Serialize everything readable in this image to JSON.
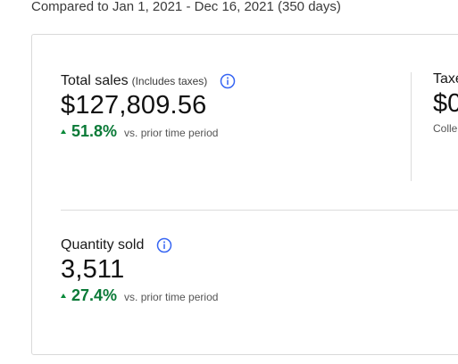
{
  "comparison_text": "Compared to Jan 1, 2021 - Dec 16, 2021 (350 days)",
  "total_sales": {
    "title": "Total sales",
    "subtitle": "(Includes taxes)",
    "value": "$127,809.56",
    "change_pct": "51.8%",
    "change_direction": "up",
    "change_note": "vs. prior time period"
  },
  "quantity_sold": {
    "title": "Quantity sold",
    "value": "3,511",
    "change_pct": "27.4%",
    "change_direction": "up",
    "change_note": "vs. prior time period"
  },
  "taxes_partial": {
    "title": "Taxe",
    "value": "$0",
    "note": "Colle"
  },
  "colors": {
    "positive": "#0a7a37",
    "info_icon": "#3665f3",
    "border": "#d9d9d9"
  },
  "icons": {
    "info": "info-circle-icon",
    "trend_up": "triangle-up-icon"
  }
}
